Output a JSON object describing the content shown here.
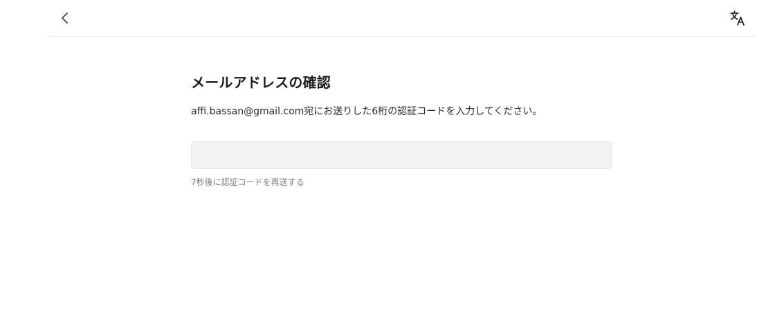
{
  "header": {
    "back_icon": "chevron-left-icon",
    "translate_icon": "translate-icon"
  },
  "verify": {
    "title": "メールアドレスの確認",
    "description": "affi.bassan@gmail.com宛にお送りした6桁の認証コードを入力してください。",
    "code_value": "",
    "code_placeholder": "",
    "resend_text": "7秒後に認証コードを再送する"
  },
  "colors": {
    "text_primary": "#1c1c1c",
    "text_secondary": "#7c7c7c",
    "input_bg": "#f3f3f3",
    "divider": "#ececec"
  }
}
